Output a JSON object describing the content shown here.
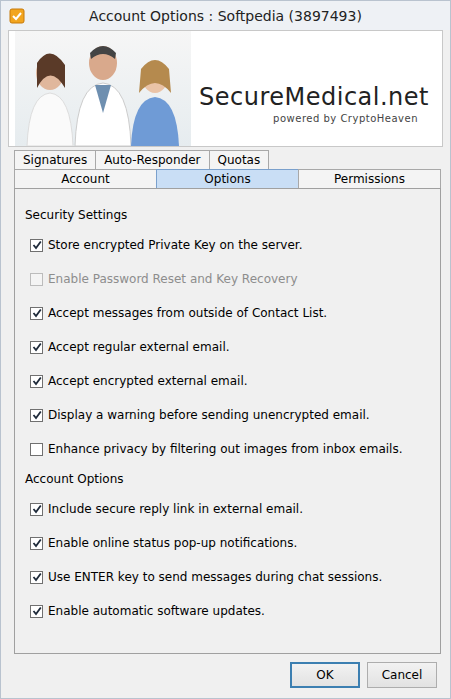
{
  "window": {
    "title": "Account Options : Softpedia (3897493)"
  },
  "banner": {
    "brand": "SecureMedical.net",
    "tagline": "powered by CryptoHeaven"
  },
  "tab_rows": [
    {
      "tabs": [
        {
          "label": "Signatures",
          "selected": false
        },
        {
          "label": "Auto-Responder",
          "selected": false
        },
        {
          "label": "Quotas",
          "selected": false
        }
      ]
    },
    {
      "tabs": [
        {
          "label": "Account",
          "selected": false
        },
        {
          "label": "Options",
          "selected": true
        },
        {
          "label": "Permissions",
          "selected": false
        }
      ]
    }
  ],
  "sections": [
    {
      "title": "Security Settings",
      "options": [
        {
          "label": "Store encrypted Private Key on the server.",
          "checked": true,
          "disabled": false
        },
        {
          "label": "Enable Password Reset and Key Recovery",
          "checked": false,
          "disabled": true
        },
        {
          "label": "Accept messages from outside of Contact List.",
          "checked": true,
          "disabled": false
        },
        {
          "label": "Accept regular external email.",
          "checked": true,
          "disabled": false
        },
        {
          "label": "Accept encrypted external email.",
          "checked": true,
          "disabled": false
        },
        {
          "label": "Display a warning before sending unencrypted email.",
          "checked": true,
          "disabled": false
        },
        {
          "label": "Enhance privacy by filtering out images from inbox emails.",
          "checked": false,
          "disabled": false
        }
      ]
    },
    {
      "title": "Account Options",
      "options": [
        {
          "label": "Include secure reply link in external email.",
          "checked": true,
          "disabled": false
        },
        {
          "label": "Enable online status pop-up notifications.",
          "checked": true,
          "disabled": false
        },
        {
          "label": "Use ENTER key to send messages during chat sessions.",
          "checked": true,
          "disabled": false
        },
        {
          "label": "Enable automatic software updates.",
          "checked": true,
          "disabled": false
        }
      ]
    }
  ],
  "buttons": [
    {
      "label": "OK",
      "default": true
    },
    {
      "label": "Cancel",
      "default": false
    }
  ]
}
